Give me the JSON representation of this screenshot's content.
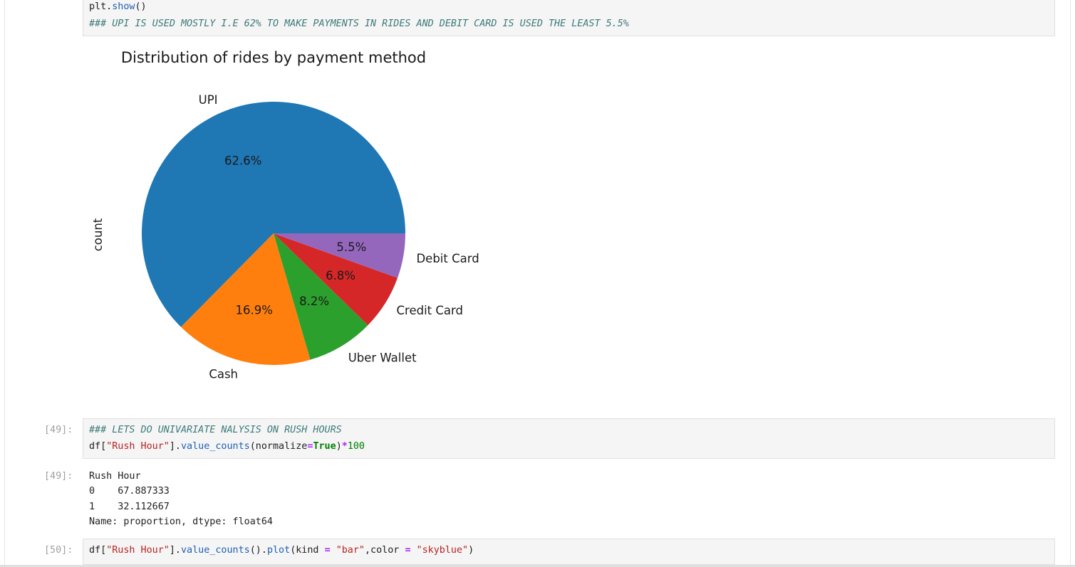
{
  "cell_top": {
    "line1": {
      "obj": "plt.",
      "fn": "show",
      "rest": "()"
    },
    "comment": "### UPI IS USED MOSTLY I.E 62% TO MAKE PAYMENTS IN RIDES AND DEBIT CARD IS USED THE LEAST 5.5%"
  },
  "chart_data": {
    "type": "pie",
    "title": "Distribution of rides by payment method",
    "ylabel": "count",
    "categories": [
      "UPI",
      "Cash",
      "Uber Wallet",
      "Credit Card",
      "Debit Card"
    ],
    "values": [
      62.6,
      16.9,
      8.2,
      6.8,
      5.5
    ],
    "value_labels": [
      "62.6%",
      "16.9%",
      "8.2%",
      "6.8%",
      "5.5%"
    ],
    "colors": [
      "#1f77b4",
      "#ff7f0e",
      "#2ca02c",
      "#d62728",
      "#9467bd"
    ]
  },
  "cell_49": {
    "prompt": "[49]:",
    "comment": "### LETS DO UNIVARIATE NALYSIS ON RUSH HOURS",
    "code": {
      "df": "df[",
      "key": "\"Rush Hour\"",
      "mid": "].",
      "fn": "value_counts",
      "open": "(normalize",
      "eq": "=",
      "kw": "True",
      "close": ")",
      "mul": "*",
      "num": "100"
    }
  },
  "out_49": {
    "prompt": "[49]:",
    "lines": [
      "Rush Hour",
      "0    67.887333",
      "1    32.112667",
      "Name: proportion, dtype: float64"
    ]
  },
  "cell_50": {
    "prompt": "[50]:",
    "code": {
      "df": "df[",
      "key": "\"Rush Hour\"",
      "mid1": "].",
      "fn1": "value_counts",
      "mid2": "().",
      "fn2": "plot",
      "open": "(kind ",
      "eq1": "=",
      "sp1": " ",
      "s1": "\"bar\"",
      "comma": ",color ",
      "eq2": "=",
      "sp2": " ",
      "s2": "\"skyblue\"",
      "close": ")"
    }
  }
}
